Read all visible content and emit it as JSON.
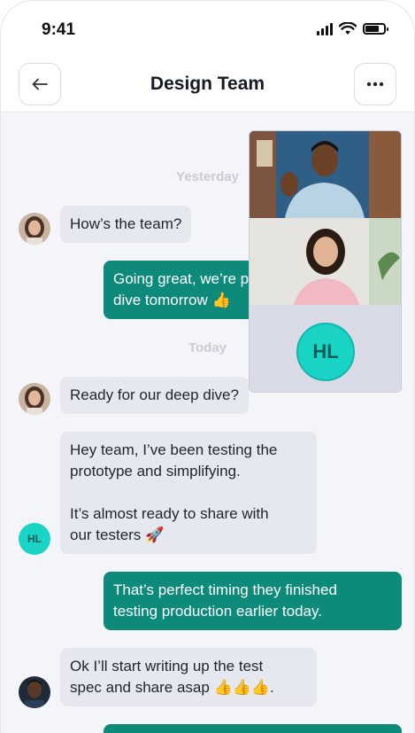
{
  "status": {
    "time": "9:41"
  },
  "header": {
    "title": "Design Team",
    "back_icon": "arrow-left-icon",
    "more_icon": "more-horizontal-icon"
  },
  "days": {
    "yesterday": "Yesterday",
    "today": "Today"
  },
  "messages": [
    {
      "text_lines": [
        "How’s the team?"
      ]
    },
    {
      "text_lines": [
        "Going great, we’re p",
        "dive tomorrow 👍"
      ]
    },
    {
      "text_lines": [
        "Ready for our deep dive?"
      ]
    },
    {
      "text_lines": [
        "Hey team, I’ve been testing the",
        "prototype and simplifying.",
        "",
        "It’s almost ready to share with",
        "our testers 🚀"
      ],
      "avatar_initials": "HL"
    },
    {
      "text_lines": [
        "That’s perfect timing they finished",
        "testing production earlier today."
      ]
    },
    {
      "text_lines": [
        "Ok I’ll start writing up the test",
        "spec and share asap 👍👍👍."
      ]
    }
  ],
  "video_call": {
    "participant_initials": "HL"
  },
  "colors": {
    "outgoing": "#0d8a7a",
    "incoming": "#e6e8ef",
    "initials_avatar": "#19d3c5"
  }
}
